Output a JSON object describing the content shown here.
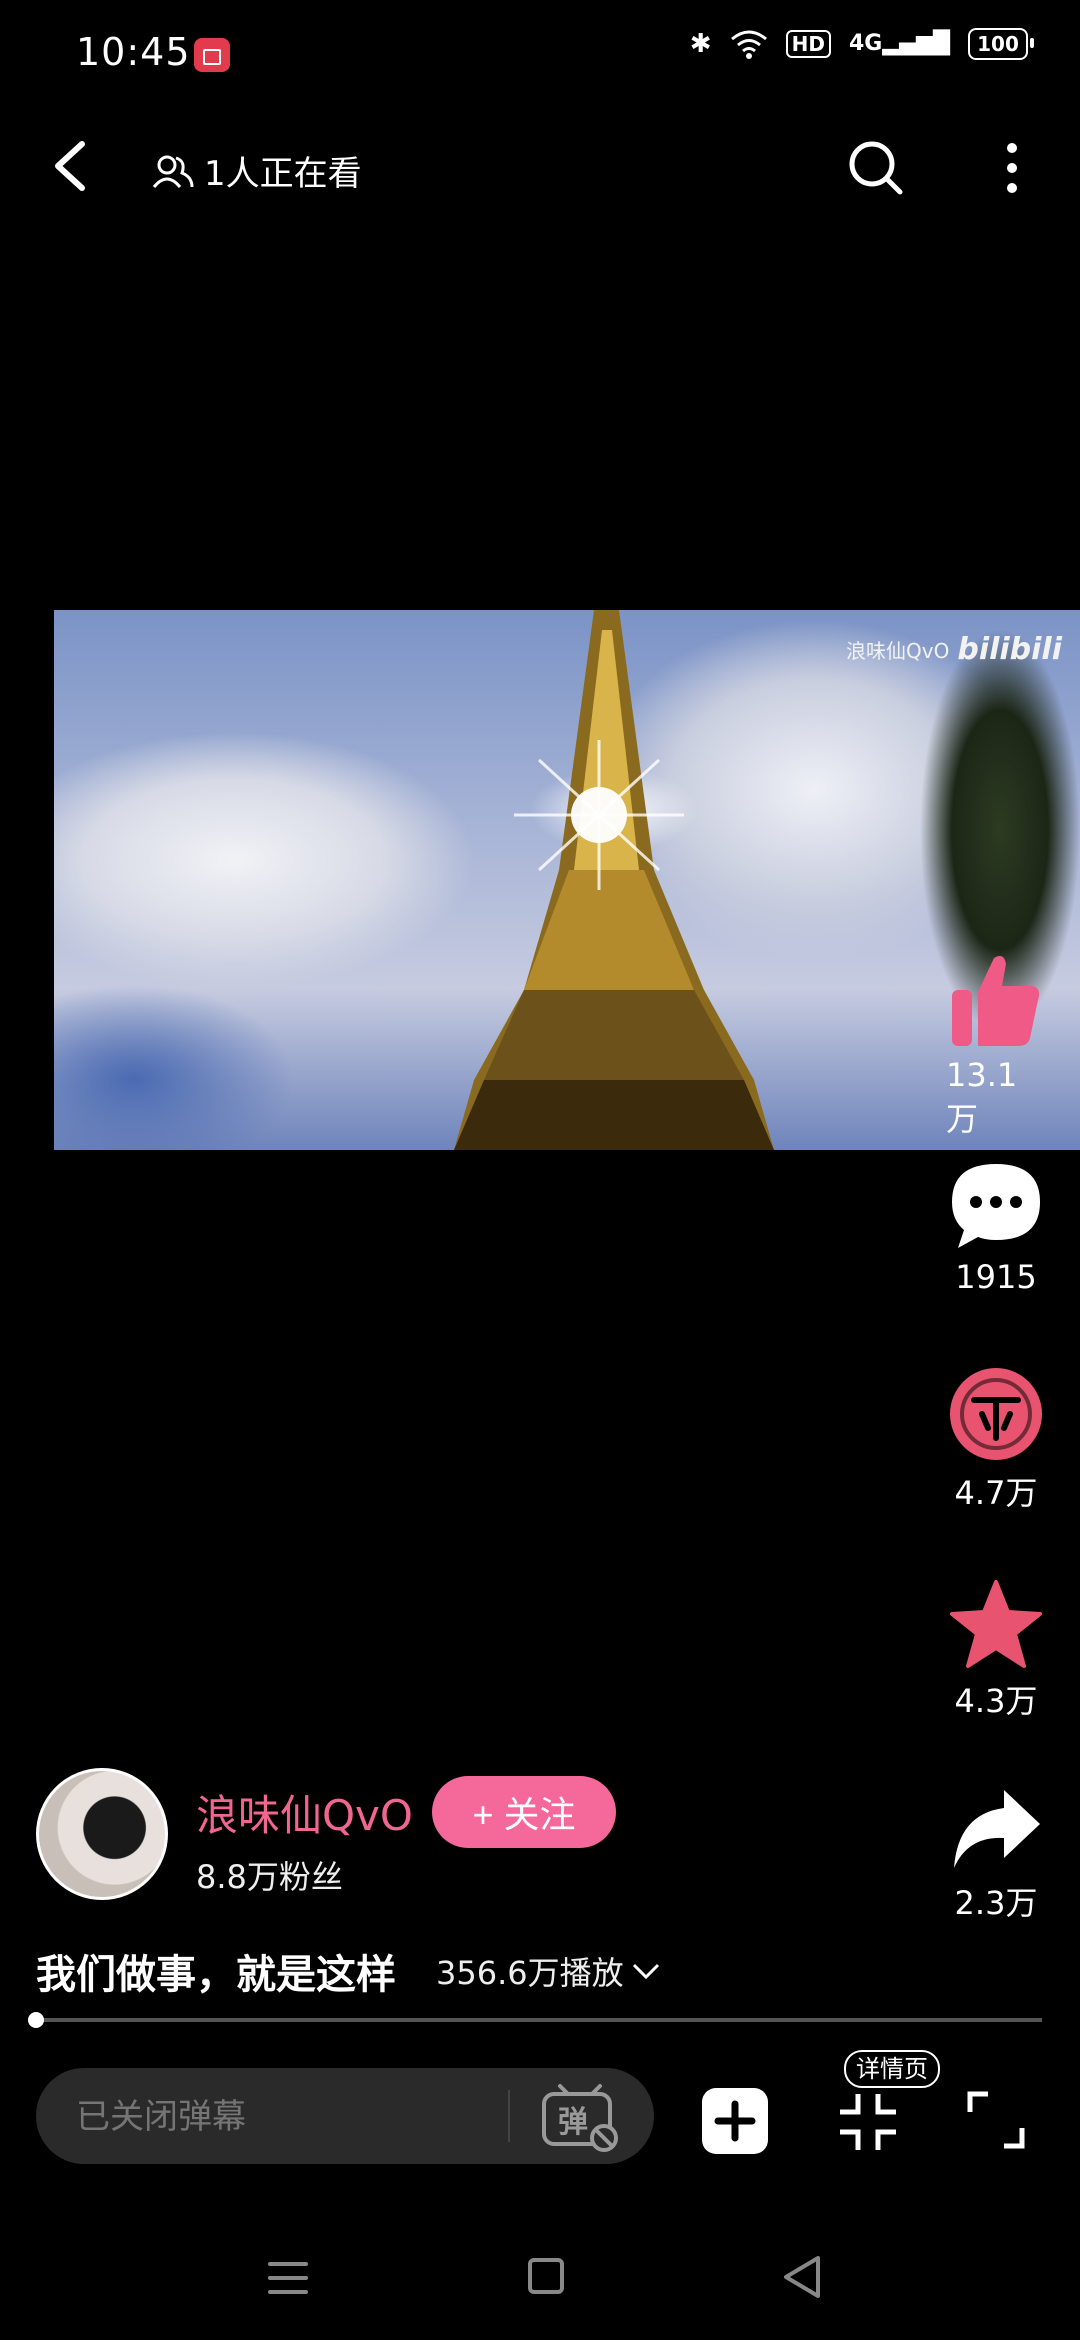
{
  "status_bar": {
    "time": "10:45",
    "network": "4G",
    "hd": "HD",
    "battery": "100"
  },
  "top_bar": {
    "viewers_text": "1人正在看"
  },
  "video": {
    "watermark_user": "浪味仙QvO",
    "watermark_logo": "bilibili"
  },
  "actions": {
    "like_count": "13.1万",
    "comment_count": "1915",
    "coin_count": "4.7万",
    "favorite_count": "4.3万",
    "share_count": "2.3万"
  },
  "author": {
    "name": "浪味仙QvO",
    "fans": "8.8万粉丝",
    "follow_label": "+ 关注"
  },
  "video_info": {
    "title": "我们做事，就是这样",
    "plays": "356.6万播放",
    "progress": 0.0
  },
  "bottom_bar": {
    "danmaku_placeholder": "已关闭弹幕",
    "danmaku_icon_text": "弹",
    "detail_label": "详情页"
  },
  "colors": {
    "accent_pink": "#f5689a",
    "author_name": "#f0668f",
    "coin_red": "#e8546f",
    "background": "#000000"
  }
}
